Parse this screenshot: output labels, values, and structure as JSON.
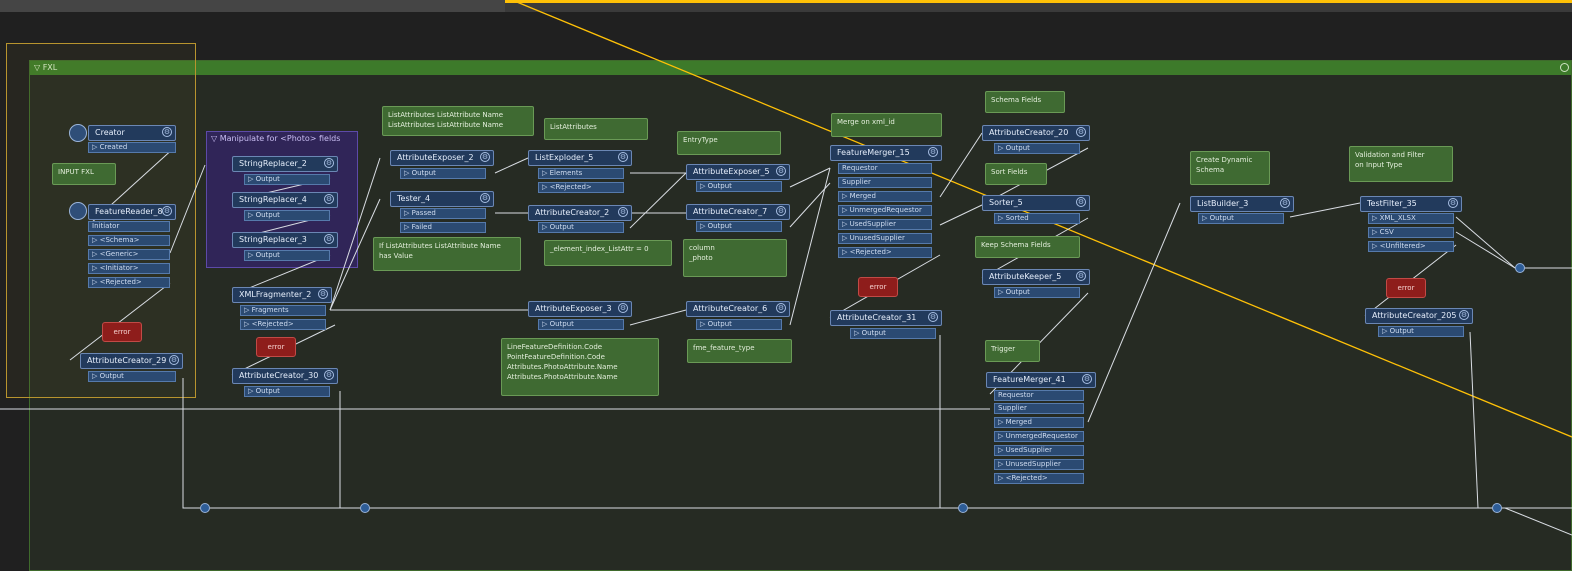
{
  "group": {
    "title": "▽ FXL"
  },
  "bookmark": {
    "title": "▽ Manipulate for <Photo> fields"
  },
  "transformers": {
    "creator": {
      "name": "Creator",
      "ports": [
        "▷ Created"
      ]
    },
    "featurereader": {
      "name": "FeatureReader_8",
      "ports": [
        "Initiator",
        "▷ <Schema>",
        "▷ <Generic>",
        "▷ <Initiator>",
        "▷ <Rejected>"
      ]
    },
    "attrcreator29": {
      "name": "AttributeCreator_29",
      "ports": [
        "▷ Output"
      ]
    },
    "strrep2": {
      "name": "StringReplacer_2",
      "ports": [
        "▷ Output"
      ]
    },
    "strrep4": {
      "name": "StringReplacer_4",
      "ports": [
        "▷ Output"
      ]
    },
    "strrep3": {
      "name": "StringReplacer_3",
      "ports": [
        "▷ Output"
      ]
    },
    "xmlfrag2": {
      "name": "XMLFragmenter_2",
      "ports": [
        "▷ Fragments",
        "▷ <Rejected>"
      ]
    },
    "attrcreator30": {
      "name": "AttributeCreator_30",
      "ports": [
        "▷ Output"
      ]
    },
    "attrexp2": {
      "name": "AttributeExposer_2",
      "ports": [
        "▷ Output"
      ]
    },
    "tester4": {
      "name": "Tester_4",
      "ports": [
        "▷ Passed",
        "▷ Failed"
      ]
    },
    "listexp5": {
      "name": "ListExploder_5",
      "ports": [
        "▷ Elements",
        "▷ <Rejected>"
      ]
    },
    "attrcreator2": {
      "name": "AttributeCreator_2",
      "ports": [
        "▷ Output"
      ]
    },
    "attrexp3": {
      "name": "AttributeExposer_3",
      "ports": [
        "▷ Output"
      ]
    },
    "attrexp5": {
      "name": "AttributeExposer_5",
      "ports": [
        "▷ Output"
      ]
    },
    "attrcreator7": {
      "name": "AttributeCreator_7",
      "ports": [
        "▷ Output"
      ]
    },
    "attrcreator6": {
      "name": "AttributeCreator_6",
      "ports": [
        "▷ Output"
      ]
    },
    "fm15": {
      "name": "FeatureMerger_15",
      "ports": [
        "Requestor",
        "Supplier",
        "▷ Merged",
        "▷ UnmergedRequestor",
        "▷ UsedSupplier",
        "▷ UnusedSupplier",
        "▷ <Rejected>"
      ]
    },
    "attrcreator31": {
      "name": "AttributeCreator_31",
      "ports": [
        "▷ Output"
      ]
    },
    "attrcreator20": {
      "name": "AttributeCreator_20",
      "ports": [
        "▷ Output"
      ]
    },
    "sorter5": {
      "name": "Sorter_5",
      "ports": [
        "▷ Sorted"
      ]
    },
    "attrkeeper5": {
      "name": "AttributeKeeper_5",
      "ports": [
        "▷ Output"
      ]
    },
    "fm41": {
      "name": "FeatureMerger_41",
      "ports": [
        "Requestor",
        "Supplier",
        "▷ Merged",
        "▷ UnmergedRequestor",
        "▷ UsedSupplier",
        "▷ UnusedSupplier",
        "▷ <Rejected>"
      ]
    },
    "listbuilder3": {
      "name": "ListBuilder_3",
      "ports": [
        "▷ Output"
      ]
    },
    "testfilter35": {
      "name": "TestFilter_35",
      "ports": [
        "▷ XML_XLSX",
        "▷ CSV",
        "▷ <Unfiltered>"
      ]
    },
    "attrcreator205": {
      "name": "AttributeCreator_205",
      "ports": [
        "▷ Output"
      ]
    }
  },
  "notes": {
    "input_fxl": "INPUT FXL",
    "list_names": "ListAttributes ListAttribute Name\nListAttributes ListAttribute Name",
    "list_attr": "ListAttributes",
    "entry_type": "EntryType",
    "merge_xml": "Merge on xml_id",
    "schema_fields": "Schema Fields",
    "sort_fields": "Sort Fields",
    "keep_schema": "Keep Schema Fields",
    "trigger": "Trigger",
    "create_dyn": "Create Dynamic\nSchema",
    "validation": "Validation and Filter\non Input Type",
    "if_list": "If ListAttributes ListAttribute Name\nhas Value",
    "element_index": "_element_index_ListAttr = 0",
    "column_photo": "column\n_photo",
    "line_feature": "LineFeatureDefinition.Code\nPointFeatureDefinition.Code\nAttributes.PhotoAttribute.Name\nAttributes.PhotoAttribute.Name",
    "fme_feature_type": "fme_feature_type"
  },
  "badges": {
    "error": "error"
  }
}
